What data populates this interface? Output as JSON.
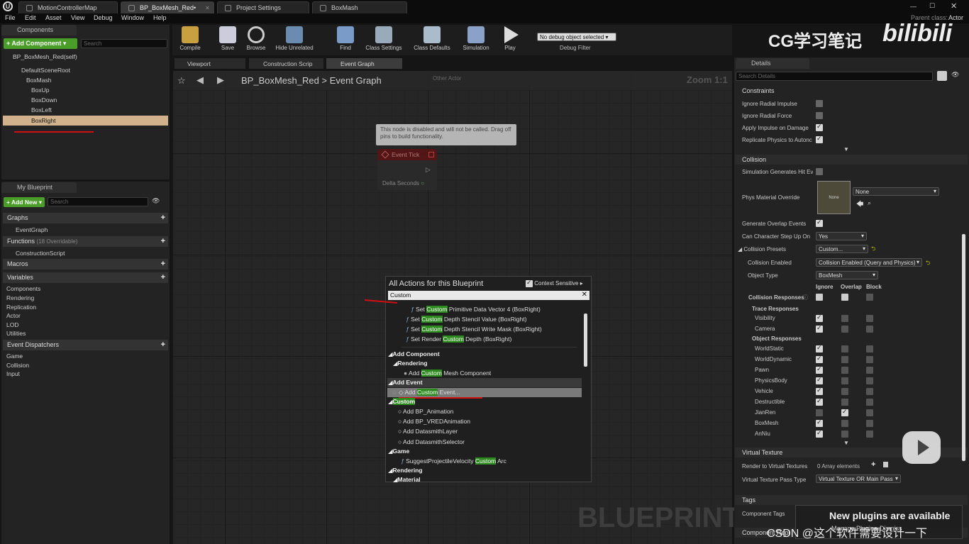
{
  "tabs": [
    "MotionControllerMap",
    "BP_BoxMesh_Red•",
    "Project Settings",
    "BoxMash"
  ],
  "parent_class_label": "Parent class:",
  "parent_class_value": "Actor",
  "menu": [
    "File",
    "Edit",
    "Asset",
    "View",
    "Debug",
    "Window",
    "Help"
  ],
  "components": {
    "title": "Components",
    "add_button": "+ Add Component ▾",
    "search_placeholder": "Search",
    "self_item": "BP_BoxMesh_Red(self)",
    "tree": [
      "DefaultSceneRoot",
      "BoxMash",
      "BoxUp",
      "BoxDown",
      "BoxLeft",
      "BoxRight"
    ]
  },
  "my_blueprint": {
    "title": "My Blueprint",
    "add_button": "+ Add New ▾",
    "search_placeholder": "Search",
    "graphs_label": "Graphs",
    "event_graph": "EventGraph",
    "functions_label": "Functions",
    "functions_count": "(18 Overridable)",
    "construction_script": "ConstructionScript",
    "macros_label": "Macros",
    "variables_label": "Variables",
    "variable_items": [
      "Components",
      "Rendering",
      "Replication",
      "Actor",
      "LOD",
      "Utilities"
    ],
    "dispatchers_label": "Event Dispatchers",
    "dispatcher_items": [
      "Game",
      "Collision",
      "Input"
    ]
  },
  "toolbar": [
    "Compile",
    "Save",
    "Browse",
    "Hide Unrelated",
    "Find",
    "Class Settings",
    "Class Defaults",
    "Simulation",
    "Play"
  ],
  "debug": {
    "select": "No debug object selected ▾",
    "label": "Debug Filter"
  },
  "watermark": "CG学习笔记",
  "bilibili": "bilibili",
  "editor_tabs": [
    "Viewport",
    "Construction Scrip",
    "Event Graph"
  ],
  "breadcrumb": {
    "bp": "BP_BoxMesh_Red",
    "sep": ">",
    "graph": "Event Graph"
  },
  "zoom": "Zoom 1:1",
  "other_actor": "Other Actor",
  "node": {
    "warning": "This node is disabled and will not be called. Drag off pins to build functionality.",
    "title": "Event Tick",
    "pin": "Delta Seconds"
  },
  "blueprint_watermark": "BLUEPRINT",
  "popup": {
    "title": "All Actions for this Blueprint",
    "context": "Context Sensitive",
    "search": "Custom",
    "items": [
      {
        "pre": "Set ",
        "hl": "Custom",
        "post": " Primitive Data Vector 4 (BoxRight)"
      },
      {
        "pre": "Set ",
        "hl": "Custom",
        "post": " Depth Stencil Value (BoxRight)"
      },
      {
        "pre": "Set ",
        "hl": "Custom",
        "post": " Depth Stencil Write Mask (BoxRight)"
      },
      {
        "pre": "Set Render ",
        "hl": "Custom",
        "post": " Depth (BoxRight)"
      }
    ],
    "cat_add_component": "Add Component",
    "cat_rendering": "Rendering",
    "mesh_item": {
      "pre": "Add ",
      "hl": "Custom",
      "post": " Mesh Component"
    },
    "cat_add_event": "Add Event",
    "event_item": {
      "pre": "Add ",
      "hl": "Custom",
      "post": " Event..."
    },
    "cat_custom": "Custom",
    "custom_items": [
      "Add BP_Animation",
      "Add BP_VREDAnimation",
      "Add DatasmithLayer",
      "Add DatasmithSelector"
    ],
    "cat_game": "Game",
    "game_item": {
      "pre": "SuggestProjectileVelocity ",
      "hl": "Custom",
      "post": " Arc"
    },
    "cat_rendering2": "Rendering",
    "cat_material": "Material"
  },
  "details": {
    "title": "Details",
    "search_placeholder": "Search Details",
    "constraints": "Constraints",
    "constraint_rows": [
      {
        "label": "Ignore Radial Impulse",
        "checked": false
      },
      {
        "label": "Ignore Radial Force",
        "checked": false
      },
      {
        "label": "Apply Impulse on Damage",
        "checked": true
      },
      {
        "label": "Replicate Physics to Autonc",
        "checked": true
      }
    ],
    "collision": "Collision",
    "sim_hit": "Simulation Generates Hit Ev",
    "phys_mat": "Phys Material Override",
    "phys_none": "None",
    "phys_select": "None",
    "gen_overlap": "Generate Overlap Events",
    "step_up": "Can Character Step Up On",
    "step_up_val": "Yes",
    "presets": "Collision Presets",
    "presets_val": "Custom...",
    "enabled": "Collision Enabled",
    "enabled_val": "Collision Enabled (Query and Physics)",
    "object_type": "Object Type",
    "object_type_val": "BoxMesh",
    "col_headers": [
      "Ignore",
      "Overlap",
      "Block"
    ],
    "responses": "Collision Responses",
    "trace": "Trace Responses",
    "trace_rows": [
      {
        "label": "Visibility",
        "v": [
          1,
          0,
          0
        ]
      },
      {
        "label": "Camera",
        "v": [
          1,
          0,
          0
        ]
      }
    ],
    "object_resp": "Object Responses",
    "object_rows": [
      {
        "label": "WorldStatic",
        "v": [
          1,
          0,
          0
        ]
      },
      {
        "label": "WorldDynamic",
        "v": [
          1,
          0,
          0
        ]
      },
      {
        "label": "Pawn",
        "v": [
          1,
          0,
          0
        ]
      },
      {
        "label": "PhysicsBody",
        "v": [
          1,
          0,
          0
        ]
      },
      {
        "label": "Vehicle",
        "v": [
          1,
          0,
          0
        ]
      },
      {
        "label": "Destructible",
        "v": [
          1,
          0,
          0
        ]
      },
      {
        "label": "JianRen",
        "v": [
          0,
          1,
          0
        ]
      },
      {
        "label": "BoxMesh",
        "v": [
          1,
          0,
          0
        ]
      },
      {
        "label": "AnNiu",
        "v": [
          1,
          0,
          0
        ]
      }
    ],
    "virtual_texture": "Virtual Texture",
    "render_vt": "Render to Virtual Textures",
    "render_vt_val": "0 Array elements",
    "vt_pass": "Virtual Texture Pass Type",
    "vt_pass_val": "Virtual Texture OR Main Pass",
    "tags": "Tags",
    "component_tags": "Component Tags",
    "component_rep": "Component Repl"
  },
  "notification": {
    "title": "New plugins are available",
    "manage": "Manage Plugins",
    "dismiss": "Dismiss"
  },
  "csdn": "CSDN @这个软件需要设计一下"
}
